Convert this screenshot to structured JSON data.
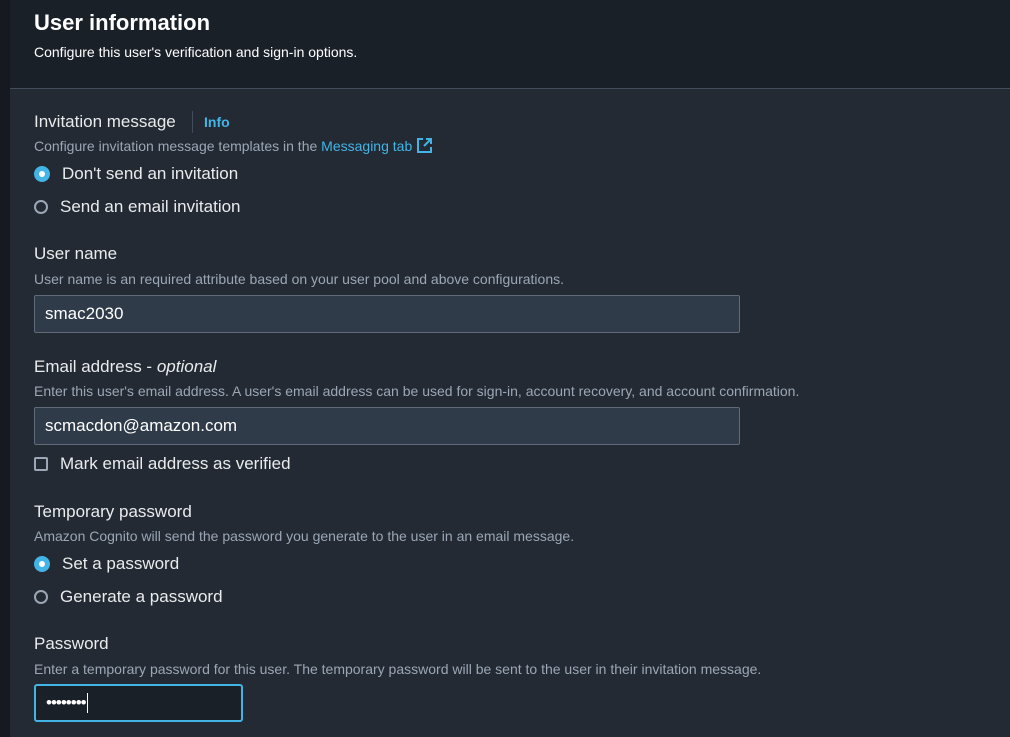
{
  "header": {
    "title": "User information",
    "description": "Configure this user's verification and sign-in options."
  },
  "invitation": {
    "label": "Invitation message",
    "info": "Info",
    "description_prefix": "Configure invitation message templates in the ",
    "messaging_link": "Messaging tab",
    "options": [
      {
        "label": "Don't send an invitation",
        "selected": true
      },
      {
        "label": "Send an email invitation",
        "selected": false
      }
    ]
  },
  "username": {
    "label": "User name",
    "description": "User name is an required attribute based on your user pool and above configurations.",
    "value": "smac2030"
  },
  "email": {
    "label": "Email address - ",
    "optional": "optional",
    "description": "Enter this user's email address. A user's email address can be used for sign-in, account recovery, and account confirmation.",
    "value": "scmacdon@amazon.com",
    "verify_label": "Mark email address as verified",
    "verified": false
  },
  "temp_password": {
    "label": "Temporary password",
    "description": "Amazon Cognito will send the password you generate to the user in an email message.",
    "options": [
      {
        "label": "Set a password",
        "selected": true
      },
      {
        "label": "Generate a password",
        "selected": false
      }
    ]
  },
  "password": {
    "label": "Password",
    "description": "Enter a temporary password for this user. The temporary password will be sent to the user in their invitation message.",
    "masked_value": "••••••••"
  },
  "colors": {
    "accent": "#42b4e6",
    "panel": "#232a33",
    "header": "#1a2028",
    "input_bg": "#303b49"
  }
}
